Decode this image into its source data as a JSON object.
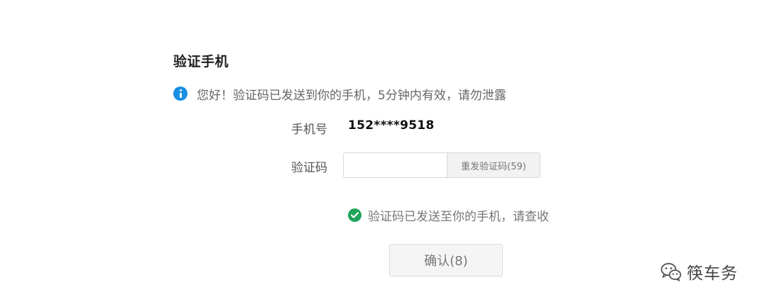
{
  "header": {
    "title": "验证手机"
  },
  "notice": {
    "icon": "info-icon",
    "text": "您好！验证码已发送到你的手机，5分钟内有效，请勿泄露"
  },
  "form": {
    "phone_label": "手机号",
    "phone_value": "152****9518",
    "code_label": "验证码",
    "code_value": "",
    "code_placeholder": "",
    "resend_label": "重发验证码(59)"
  },
  "status": {
    "icon": "check-circle-icon",
    "text": "验证码已发送至你的手机，请查收"
  },
  "actions": {
    "confirm_label": "确认(8)"
  },
  "watermark": {
    "icon": "wechat-icon",
    "text": "筷车务"
  },
  "colors": {
    "info": "#1a8fe3",
    "success": "#20a35b",
    "button_bg": "#f5f5f5",
    "border": "#d9d9d9"
  }
}
